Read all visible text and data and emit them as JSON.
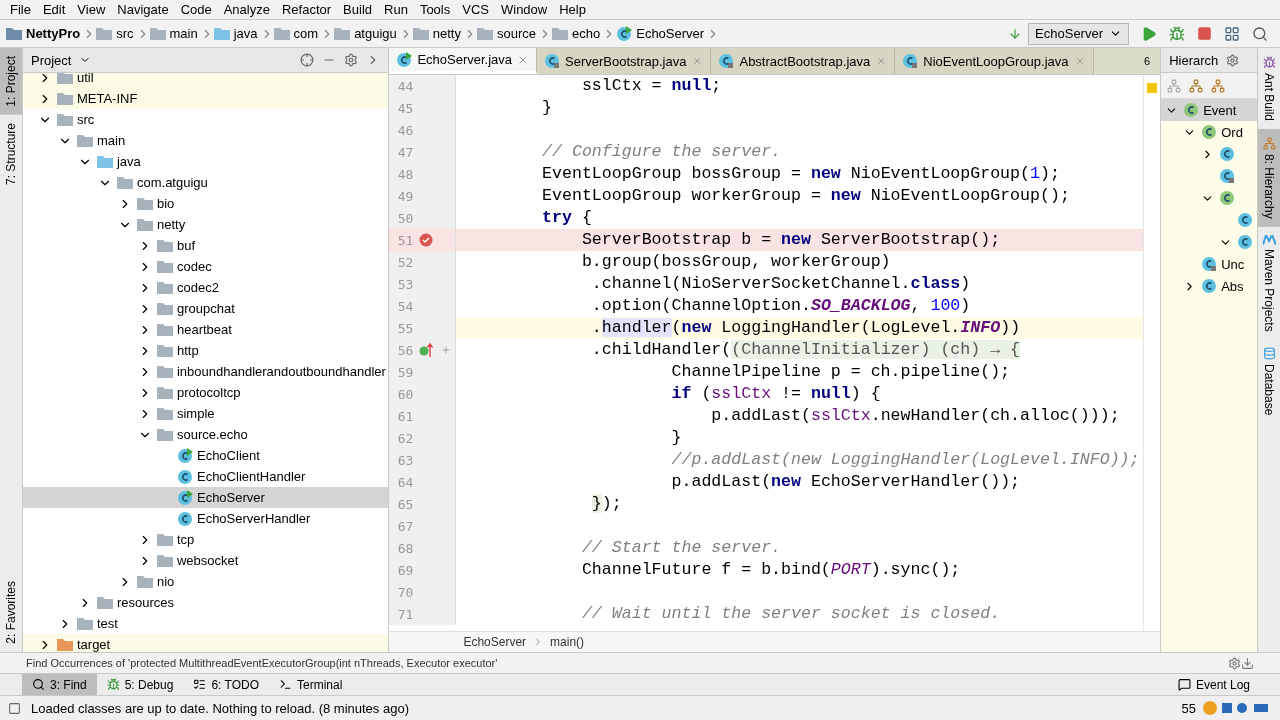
{
  "menu": [
    "File",
    "Edit",
    "View",
    "Navigate",
    "Code",
    "Analyze",
    "Refactor",
    "Build",
    "Run",
    "Tools",
    "VCS",
    "Window",
    "Help"
  ],
  "navigation": {
    "breadcrumb": [
      {
        "label": "NettyPro",
        "kind": "project"
      },
      {
        "label": "src",
        "kind": "folder"
      },
      {
        "label": "main",
        "kind": "folder"
      },
      {
        "label": "java",
        "kind": "source"
      },
      {
        "label": "com",
        "kind": "folder"
      },
      {
        "label": "atguigu",
        "kind": "folder"
      },
      {
        "label": "netty",
        "kind": "folder"
      },
      {
        "label": "source",
        "kind": "folder"
      },
      {
        "label": "echo",
        "kind": "folder"
      },
      {
        "label": "EchoServer",
        "kind": "run-class"
      }
    ],
    "run_configuration": "EchoServer"
  },
  "left_stripe": [
    {
      "label": "1: Project",
      "selected": true
    },
    {
      "label": "7: Structure",
      "selected": false
    },
    {
      "label": "2: Favorites",
      "selected": false
    }
  ],
  "project": {
    "title": "Project",
    "tree": [
      {
        "label": "util",
        "kind": "lib-folder",
        "expanded": false,
        "selected": false,
        "excluded": true
      },
      {
        "label": "META-INF",
        "kind": "lib-folder",
        "expanded": false,
        "selected": false,
        "excluded": true
      },
      {
        "label": "src",
        "kind": "folder",
        "expanded": true,
        "selected": false,
        "excluded": false,
        "children": [
          {
            "label": "main",
            "kind": "folder",
            "expanded": true,
            "selected": false,
            "excluded": false,
            "children": [
              {
                "label": "java",
                "kind": "source",
                "expanded": true,
                "selected": false,
                "excluded": false,
                "children": [
                  {
                    "label": "com.atguigu",
                    "kind": "folder",
                    "expanded": true,
                    "selected": false,
                    "excluded": false,
                    "children": [
                      {
                        "label": "bio",
                        "kind": "folder",
                        "expanded": false,
                        "selected": false,
                        "excluded": false
                      },
                      {
                        "label": "netty",
                        "kind": "folder",
                        "expanded": true,
                        "selected": false,
                        "excluded": false,
                        "children": [
                          {
                            "label": "buf",
                            "kind": "folder",
                            "expanded": false,
                            "selected": false,
                            "excluded": false
                          },
                          {
                            "label": "codec",
                            "kind": "folder",
                            "expanded": false,
                            "selected": false,
                            "excluded": false
                          },
                          {
                            "label": "codec2",
                            "kind": "folder",
                            "expanded": false,
                            "selected": false,
                            "excluded": false
                          },
                          {
                            "label": "groupchat",
                            "kind": "folder",
                            "expanded": false,
                            "selected": false,
                            "excluded": false
                          },
                          {
                            "label": "heartbeat",
                            "kind": "folder",
                            "expanded": false,
                            "selected": false,
                            "excluded": false
                          },
                          {
                            "label": "http",
                            "kind": "folder",
                            "expanded": false,
                            "selected": false,
                            "excluded": false
                          },
                          {
                            "label": "inboundhandlerandoutboundhandler",
                            "kind": "folder",
                            "expanded": false,
                            "selected": false,
                            "excluded": false
                          },
                          {
                            "label": "protocoltcp",
                            "kind": "folder",
                            "expanded": false,
                            "selected": false,
                            "excluded": false
                          },
                          {
                            "label": "simple",
                            "kind": "folder",
                            "expanded": false,
                            "selected": false,
                            "excluded": false
                          },
                          {
                            "label": "source.echo",
                            "kind": "folder",
                            "expanded": true,
                            "selected": false,
                            "excluded": false,
                            "children": [
                              {
                                "label": "EchoClient",
                                "kind": "run-class",
                                "selected": false,
                                "excluded": false
                              },
                              {
                                "label": "EchoClientHandler",
                                "kind": "class",
                                "selected": false,
                                "excluded": false
                              },
                              {
                                "label": "EchoServer",
                                "kind": "run-class",
                                "selected": true,
                                "excluded": false
                              },
                              {
                                "label": "EchoServerHandler",
                                "kind": "class",
                                "selected": false,
                                "excluded": false
                              }
                            ]
                          },
                          {
                            "label": "tcp",
                            "kind": "folder",
                            "expanded": false,
                            "selected": false,
                            "excluded": false
                          },
                          {
                            "label": "websocket",
                            "kind": "folder",
                            "expanded": false,
                            "selected": false,
                            "excluded": false
                          }
                        ]
                      },
                      {
                        "label": "nio",
                        "kind": "folder",
                        "expanded": false,
                        "selected": false,
                        "excluded": false
                      }
                    ]
                  }
                ]
              },
              {
                "label": "resources",
                "kind": "resources",
                "expanded": false,
                "selected": false,
                "excluded": false
              }
            ]
          },
          {
            "label": "test",
            "kind": "folder",
            "expanded": false,
            "selected": false,
            "excluded": false
          }
        ]
      },
      {
        "label": "target",
        "kind": "target",
        "expanded": false,
        "selected": false,
        "excluded": true
      }
    ]
  },
  "editor": {
    "tabs": [
      {
        "label": "EchoServer.java",
        "kind": "run-class",
        "selected": true
      },
      {
        "label": "ServerBootstrap.java",
        "kind": "locked-class",
        "selected": false
      },
      {
        "label": "AbstractBootstrap.java",
        "kind": "locked-class",
        "selected": false
      },
      {
        "label": "NioEventLoopGroup.java",
        "kind": "locked-class",
        "selected": false
      }
    ],
    "hidden_tab_count": "6",
    "lines": [
      {
        "number": "44",
        "code": [
          {
            "kind": "plain",
            "text": "            sslCtx = "
          },
          {
            "kind": "kw",
            "text": "null"
          },
          {
            "kind": "plain",
            "text": ";"
          }
        ]
      },
      {
        "number": "45",
        "code": [
          {
            "kind": "plain",
            "text": "        }"
          }
        ]
      },
      {
        "number": "46"
      },
      {
        "number": "47",
        "code": [
          {
            "kind": "comment",
            "text": "        // Configure the server."
          }
        ]
      },
      {
        "number": "48",
        "code": [
          {
            "kind": "plain",
            "text": "        EventLoopGroup bossGroup = "
          },
          {
            "kind": "kw",
            "text": "new"
          },
          {
            "kind": "plain",
            "text": " NioEventLoopGroup("
          },
          {
            "kind": "num",
            "text": "1"
          },
          {
            "kind": "plain",
            "text": ");"
          }
        ]
      },
      {
        "number": "49",
        "code": [
          {
            "kind": "plain",
            "text": "        EventLoopGroup workerGroup = "
          },
          {
            "kind": "kw",
            "text": "new"
          },
          {
            "kind": "plain",
            "text": " NioEventLoopGroup();"
          }
        ]
      },
      {
        "number": "50",
        "code": [
          {
            "kind": "kw",
            "text": "        try"
          },
          {
            "kind": "plain",
            "text": " {"
          }
        ]
      },
      {
        "number": "51",
        "breakpoint": true,
        "code": [
          {
            "kind": "plain",
            "text": "            ServerBootstrap b = "
          },
          {
            "kind": "kw",
            "text": "new"
          },
          {
            "kind": "plain",
            "text": " ServerBootstrap();"
          }
        ]
      },
      {
        "number": "52",
        "code": [
          {
            "kind": "plain",
            "text": "            b.group(bossGroup, workerGroup)"
          }
        ]
      },
      {
        "number": "53",
        "code": [
          {
            "kind": "plain",
            "text": "             .channel(NioServerSocketChannel."
          },
          {
            "kind": "kw",
            "text": "class"
          },
          {
            "kind": "plain",
            "text": ")"
          }
        ]
      },
      {
        "number": "54",
        "code": [
          {
            "kind": "plain",
            "text": "             .option(ChannelOption."
          },
          {
            "kind": "static",
            "text": "SO_BACKLOG"
          },
          {
            "kind": "plain",
            "text": ", "
          },
          {
            "kind": "num",
            "text": "100"
          },
          {
            "kind": "plain",
            "text": ")"
          }
        ]
      },
      {
        "number": "55",
        "caret_line": true,
        "code": [
          {
            "kind": "plain",
            "text": "             ."
          },
          {
            "kind": "usage",
            "text": "handler"
          },
          {
            "kind": "plain",
            "text": "("
          },
          {
            "kind": "kw",
            "text": "new"
          },
          {
            "kind": "plain",
            "text": " LoggingHandler(LogLevel."
          },
          {
            "kind": "static",
            "text": "INFO"
          },
          {
            "kind": "plain",
            "text": "))"
          }
        ]
      },
      {
        "number": "56",
        "implements": true,
        "fold": true,
        "code": [
          {
            "kind": "plain",
            "text": "             .childHandler("
          },
          {
            "kind": "lambda",
            "text": "(ChannelInitializer) (ch) → {"
          }
        ]
      },
      {
        "number": "59",
        "code": [
          {
            "kind": "plain",
            "text": "                     ChannelPipeline p = ch.pipeline();"
          }
        ]
      },
      {
        "number": "60",
        "code": [
          {
            "kind": "kw",
            "text": "                     if"
          },
          {
            "kind": "plain",
            "text": " ("
          },
          {
            "kind": "field",
            "text": "sslCtx"
          },
          {
            "kind": "plain",
            "text": " != "
          },
          {
            "kind": "kw",
            "text": "null"
          },
          {
            "kind": "plain",
            "text": ") {"
          }
        ]
      },
      {
        "number": "61",
        "code": [
          {
            "kind": "plain",
            "text": "                         p.addLast("
          },
          {
            "kind": "field",
            "text": "sslCtx"
          },
          {
            "kind": "plain",
            "text": ".newHandler(ch.alloc()));"
          }
        ]
      },
      {
        "number": "62",
        "code": [
          {
            "kind": "plain",
            "text": "                     }"
          }
        ]
      },
      {
        "number": "63",
        "code": [
          {
            "kind": "comment",
            "text": "                     //p.addLast(new LoggingHandler(LogLevel.INFO));"
          }
        ]
      },
      {
        "number": "64",
        "code": [
          {
            "kind": "plain",
            "text": "                     p.addLast("
          },
          {
            "kind": "kw",
            "text": "new"
          },
          {
            "kind": "plain",
            "text": " EchoServerHandler());"
          }
        ]
      },
      {
        "number": "65",
        "code": [
          {
            "kind": "lambda",
            "text": "             }"
          },
          {
            "kind": "plain",
            "text": ");"
          }
        ]
      },
      {
        "number": "67"
      },
      {
        "number": "68",
        "code": [
          {
            "kind": "comment",
            "text": "            // Start the server."
          }
        ]
      },
      {
        "number": "69",
        "code": [
          {
            "kind": "plain",
            "text": "            ChannelFuture f = b.bind("
          },
          {
            "kind": "const",
            "text": "PORT"
          },
          {
            "kind": "plain",
            "text": ").sync();"
          }
        ]
      },
      {
        "number": "70"
      },
      {
        "number": "71",
        "code": [
          {
            "kind": "comment",
            "text": "            // Wait until the server socket is closed."
          }
        ]
      }
    ],
    "breadcrumb": [
      "EchoServer",
      "main()"
    ]
  },
  "hierarchy": {
    "title": "Hierarch",
    "tree": [
      {
        "label": "Event",
        "kind": "interface",
        "expanded": true,
        "selected": true,
        "children": [
          {
            "label": "Ord",
            "kind": "interface",
            "expanded": true,
            "selected": false,
            "children": [
              {
                "kind": "class",
                "expanded": false,
                "selected": false
              },
              {
                "kind": "abstract-class",
                "selected": false
              },
              {
                "kind": "interface",
                "expanded": true,
                "selected": false,
                "children": [
                  {
                    "kind": "class",
                    "selected": false
                  },
                  {
                    "kind": "class",
                    "expanded": true,
                    "selected": false
                  }
                ]
              }
            ]
          },
          {
            "label": "Unc",
            "kind": "abstract-class",
            "selected": false
          },
          {
            "label": "Abs",
            "kind": "class",
            "expanded": false,
            "selected": false
          }
        ]
      }
    ]
  },
  "right_stripe": [
    {
      "label": "Ant Build",
      "kind": "ant",
      "selected": false
    },
    {
      "label": "8: Hierarchy",
      "kind": "hierarchy",
      "selected": true
    },
    {
      "label": "Maven Projects",
      "kind": "maven",
      "selected": false
    },
    {
      "label": "Database",
      "kind": "database",
      "selected": false
    }
  ],
  "find_bar": "Find Occurrences of 'protected MultithreadEventExecutorGroup(int nThreads, Executor executor'",
  "tool_tabs": [
    {
      "label": "3: Find",
      "kind": "find",
      "selected": true
    },
    {
      "label": "5: Debug",
      "kind": "debug",
      "selected": false
    },
    {
      "label": "6: TODO",
      "kind": "todo",
      "selected": false
    },
    {
      "label": "Terminal",
      "kind": "terminal",
      "selected": false
    }
  ],
  "event_log": "Event Log",
  "status": {
    "message": "Loaded classes are up to date. Nothing to reload. (8 minutes ago)",
    "reading": "55"
  }
}
